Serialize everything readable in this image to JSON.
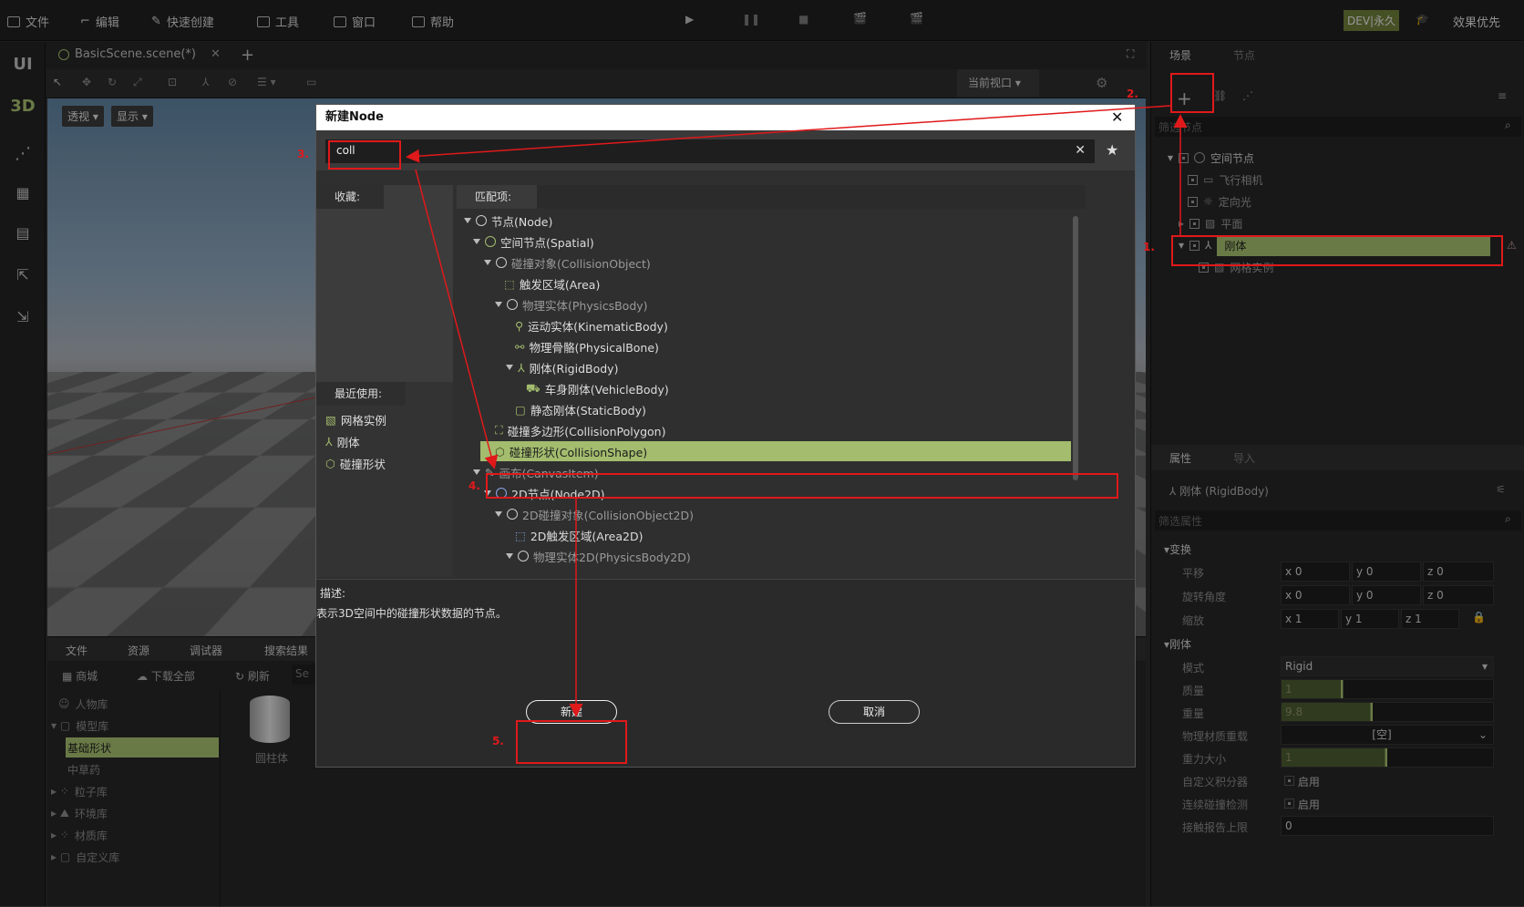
{
  "menubar": {
    "items": [
      "文件",
      "编辑",
      "快速创建",
      "工具",
      "窗口",
      "帮助"
    ],
    "dev_badge": "DEV|永久",
    "quality": "效果优先"
  },
  "leftbar": {
    "ui": "UI",
    "three_d": "3D"
  },
  "scene_tab": {
    "name": "BasicScene.scene(*)"
  },
  "viewport": {
    "perspective_btn": "透视",
    "display_btn": "显示",
    "current_view": "当前视口"
  },
  "bottom": {
    "tabs": [
      "文件",
      "资源",
      "调试器",
      "搜索结果"
    ],
    "toolbar": [
      "商城",
      "下载全部",
      "刷新"
    ],
    "search_placeholder": "Se",
    "tree": [
      "人物库",
      "模型库",
      "基础形状",
      "中草药",
      "粒子库",
      "环境库",
      "材质库",
      "自定义库"
    ],
    "asset": "圆柱体"
  },
  "right": {
    "tabs": [
      "场景",
      "节点"
    ],
    "filter_placeholder": "筛选节点",
    "tree": [
      "空间节点",
      "飞行相机",
      "定向光",
      "平面",
      "刚体",
      "网格实例"
    ],
    "prop_tabs": [
      "属性",
      "导入"
    ],
    "selected": "刚体 (RigidBody)",
    "prop_filter": "筛选属性",
    "transform": {
      "header": "变换",
      "labels": [
        "平移",
        "旋转角度",
        "缩放"
      ],
      "values": [
        [
          "0",
          "0",
          "0"
        ],
        [
          "0",
          "0",
          "0"
        ],
        [
          "1",
          "1",
          "1"
        ]
      ]
    },
    "rigid": {
      "header": "刚体",
      "labels": [
        "模式",
        "质量",
        "重量",
        "物理材质重载",
        "重力大小",
        "自定义积分器",
        "连续碰撞检测",
        "接触报告上限"
      ],
      "mode": "Rigid",
      "mass": "1",
      "weight": "9.8",
      "material": "[空]",
      "gravity": "1",
      "enable": "启用",
      "contacts": "0"
    }
  },
  "dialog": {
    "title": "新建Node",
    "search_value": "coll",
    "favorites_header": "收藏:",
    "matches_header": "匹配项:",
    "recent_header": "最近使用:",
    "recent": [
      "网格实例",
      "刚体",
      "碰撞形状"
    ],
    "tree": [
      "节点(Node)",
      "空间节点(Spatial)",
      "碰撞对象(CollisionObject)",
      "触发区域(Area)",
      "物理实体(PhysicsBody)",
      "运动实体(KinematicBody)",
      "物理骨骼(PhysicalBone)",
      "刚体(RigidBody)",
      "车身刚体(VehicleBody)",
      "静态刚体(StaticBody)",
      "碰撞多边形(CollisionPolygon)",
      "碰撞形状(CollisionShape)",
      "画布(CanvasItem)",
      "2D节点(Node2D)",
      "2D碰撞对象(CollisionObject2D)",
      "2D触发区域(Area2D)",
      "物理实体2D(PhysicsBody2D)"
    ],
    "desc_label": "描述:",
    "desc": "表示3D空间中的碰撞形状数据的节点。",
    "create": "新建",
    "cancel": "取消"
  },
  "annotations": [
    "1.",
    "2.",
    "3.",
    "4.",
    "5."
  ],
  "colors": {
    "highlight": "#a3bc6e",
    "annotation": "#e0191b"
  }
}
